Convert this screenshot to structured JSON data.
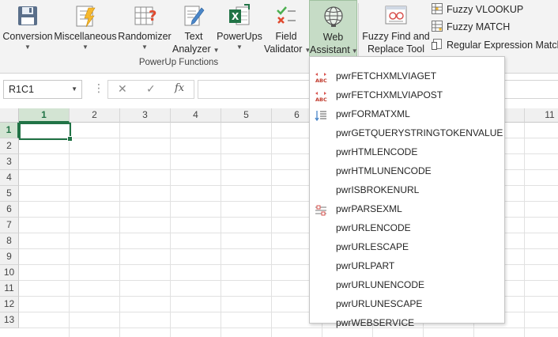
{
  "ribbon": {
    "buttons": [
      {
        "name": "conversion-button",
        "label": "Conversion",
        "has_caret": true
      },
      {
        "name": "miscellaneous-button",
        "label": "Miscellaneous",
        "has_caret": true
      },
      {
        "name": "randomizer-button",
        "label": "Randomizer",
        "has_caret": true
      },
      {
        "name": "text-analyzer-button",
        "label": "Text Analyzer",
        "has_caret": true
      },
      {
        "name": "powerups-button",
        "label": "PowerUps",
        "has_caret": true
      },
      {
        "name": "field-validator-button",
        "label": "Field Validator",
        "has_caret": true
      },
      {
        "name": "web-assistant-button",
        "label": "Web Assistant",
        "has_caret": true
      }
    ],
    "conversion": {
      "line1": "Conversion"
    },
    "miscellaneous": {
      "line1": "Miscellaneous"
    },
    "randomizer": {
      "line1": "Randomizer"
    },
    "text_analyzer": {
      "line1": "Text",
      "line2": "Analyzer"
    },
    "powerups": {
      "line1": "PowerUps"
    },
    "field_validator": {
      "line1": "Field",
      "line2": "Validator"
    },
    "web_assistant": {
      "line1": "Web",
      "line2": "Assistant"
    },
    "fuzzy_find": {
      "line1": "Fuzzy Find and",
      "line2": "Replace Tool"
    },
    "group_label": "PowerUp Functions",
    "small_buttons": {
      "fuzzy_vlookup": "Fuzzy VLOOKUP",
      "fuzzy_match": "Fuzzy MATCH",
      "regex_match": "Regular Expression Match"
    }
  },
  "formula_bar": {
    "name_box": "R1C1",
    "cancel_glyph": "✕",
    "enter_glyph": "✓",
    "fx_glyph": "fx",
    "value": ""
  },
  "grid": {
    "columns": [
      "1",
      "2",
      "3",
      "4",
      "5",
      "6",
      "",
      "",
      "",
      "",
      "11"
    ],
    "rows": [
      "1",
      "2",
      "3",
      "4",
      "5",
      "6",
      "7",
      "8",
      "9",
      "10",
      "11",
      "12",
      "13"
    ],
    "active_cell": "R1C1"
  },
  "menu": {
    "items": [
      {
        "label": "pwrFETCHXMLVIAGET",
        "icon": "abc-red-icon"
      },
      {
        "label": "pwrFETCHXMLVIAPOST",
        "icon": "abc-red-icon"
      },
      {
        "label": "pwrFORMATXML",
        "icon": "indent-icon"
      },
      {
        "label": "pwrGETQUERYSTRINGTOKENVALUE",
        "icon": ""
      },
      {
        "label": "pwrHTMLENCODE",
        "icon": ""
      },
      {
        "label": "pwrHTMLUNENCODE",
        "icon": ""
      },
      {
        "label": "pwrISBROKENURL",
        "icon": ""
      },
      {
        "label": "pwrPARSEXML",
        "icon": "parse-icon"
      },
      {
        "label": "pwrURLENCODE",
        "icon": ""
      },
      {
        "label": "pwrURLESCAPE",
        "icon": ""
      },
      {
        "label": "pwrURLPART",
        "icon": ""
      },
      {
        "label": "pwrURLUNENCODE",
        "icon": ""
      },
      {
        "label": "pwrURLUNESCAPE",
        "icon": ""
      },
      {
        "label": "pwrWEBSERVICE",
        "icon": ""
      }
    ]
  },
  "colors": {
    "accent": "#217346",
    "active_button": "#c6dcc6"
  }
}
